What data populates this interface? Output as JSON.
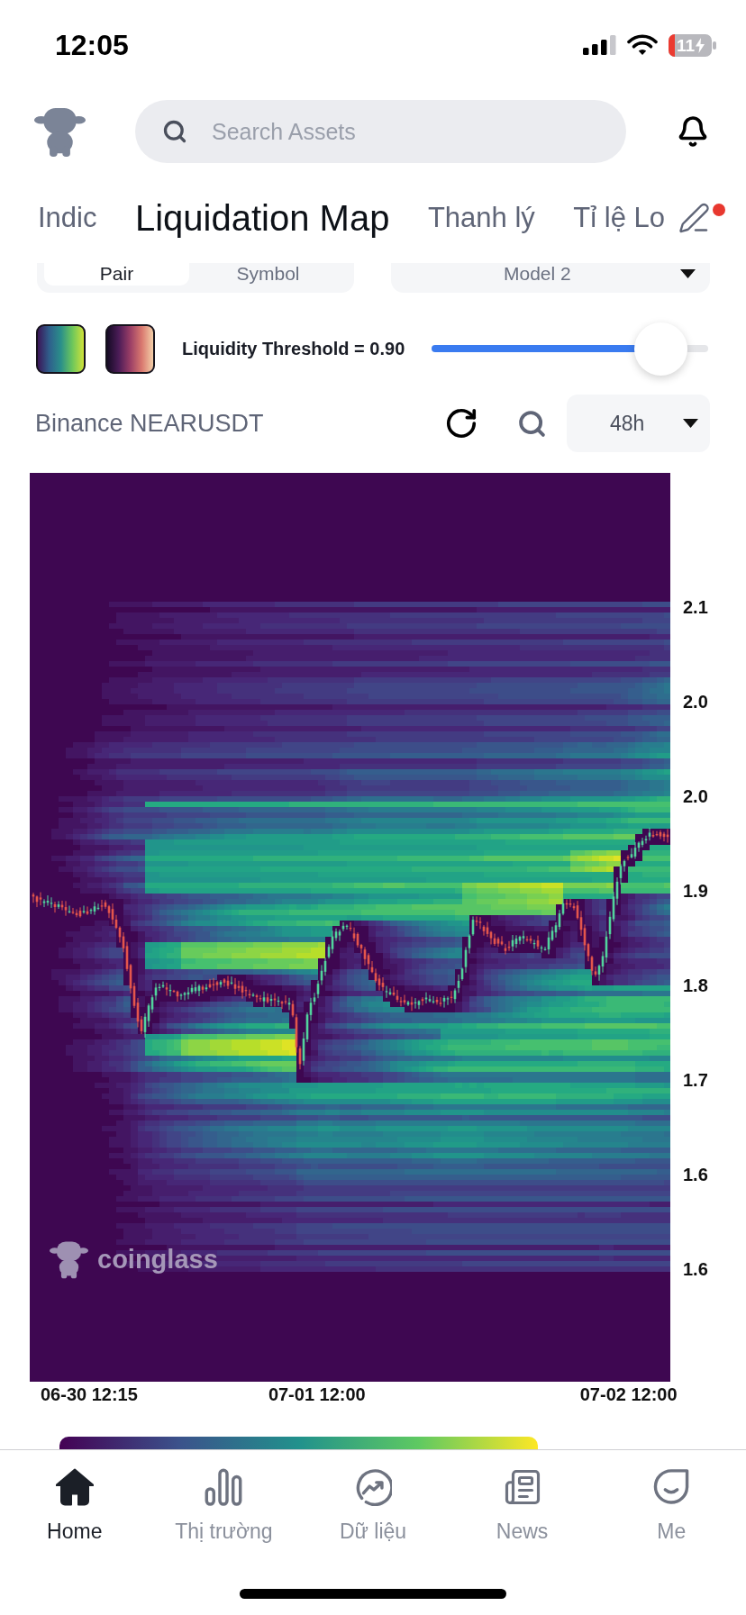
{
  "status_bar": {
    "time": "12:05",
    "battery": "11"
  },
  "search": {
    "placeholder": "Search Assets"
  },
  "tabs": [
    {
      "label": "Indic",
      "selected": false
    },
    {
      "label": "Liquidation Map",
      "selected": true
    },
    {
      "label": "Thanh lý",
      "selected": false
    },
    {
      "label": "Tỉ lệ Lo",
      "selected": false
    }
  ],
  "edit": {
    "badge": true
  },
  "options": {
    "segments": [
      {
        "label": "Pair",
        "selected": true
      },
      {
        "label": "Symbol",
        "selected": false
      }
    ],
    "model": "Model 2"
  },
  "palettes": [
    {
      "kind": "viridis"
    },
    {
      "kind": "magma"
    }
  ],
  "threshold": {
    "label": "Liquidity Threshold = 0.90",
    "level": 0.83
  },
  "market": {
    "title": "Binance NEARUSDT",
    "interval": "48h"
  },
  "chart": {
    "watermark": "coinglass",
    "y_labels": [
      "2.1",
      "2.0",
      "2.0",
      "1.9",
      "1.8",
      "1.7",
      "1.6",
      "1.6"
    ],
    "x_labels": [
      "06-30 12:15",
      "07-01 12:00",
      "07-02 12:00"
    ]
  },
  "bottom_nav": [
    {
      "kind": "home",
      "label": "Home",
      "selected": true
    },
    {
      "kind": "market",
      "label": "Thị trường",
      "selected": false
    },
    {
      "kind": "data",
      "label": "Dữ liệu",
      "selected": false
    },
    {
      "kind": "news",
      "label": "News",
      "selected": false
    },
    {
      "kind": "me",
      "label": "Me",
      "selected": false
    }
  ]
}
